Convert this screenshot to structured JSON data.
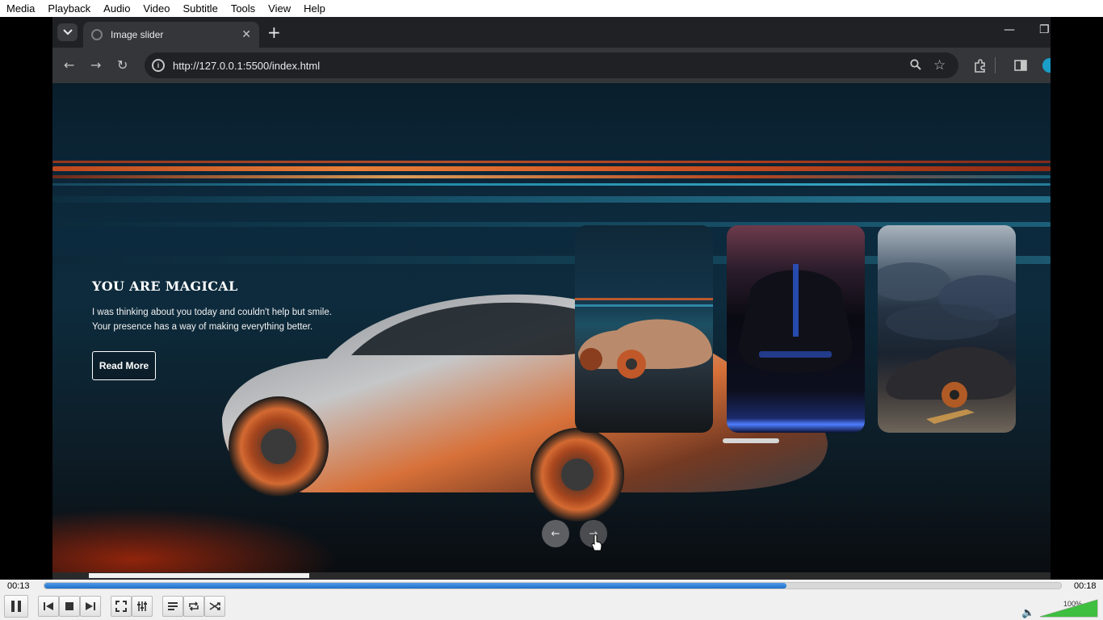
{
  "vlc": {
    "menu": [
      "Media",
      "Playback",
      "Audio",
      "Video",
      "Subtitle",
      "Tools",
      "View",
      "Help"
    ],
    "elapsed": "00:13",
    "total": "00:18",
    "progress_percent": 73,
    "volume_label": "100%",
    "volume_percent": 100
  },
  "browser": {
    "tab_title": "Image slider",
    "url": "http://127.0.0.1:5500/index.html"
  },
  "slider": {
    "title": "YOU ARE MAGICAL",
    "text": "I was thinking about you today and couldn't help but smile. Your presence has a way of making everything better.",
    "button_label": "Read More",
    "prev_glyph": "←",
    "next_glyph": "→"
  }
}
